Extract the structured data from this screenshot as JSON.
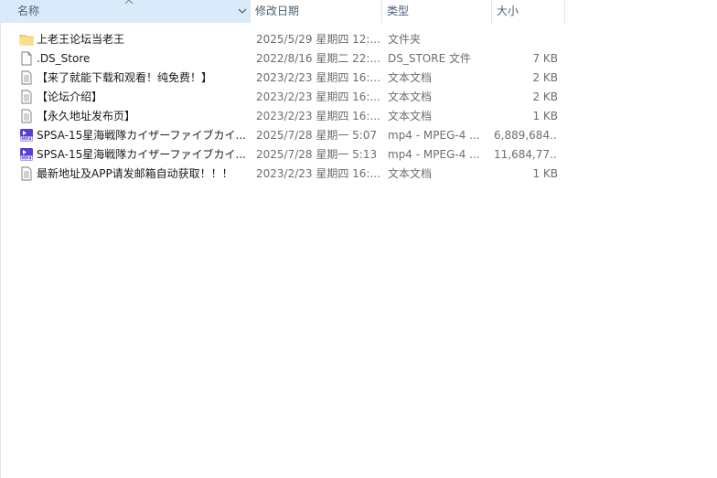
{
  "header": {
    "name": "名称",
    "date": "修改日期",
    "type": "类型",
    "size": "大小"
  },
  "files": [
    {
      "icon": "folder-icon",
      "name": "上老王论坛当老王",
      "date": "2025/5/29 星期四 12:...",
      "type": "文件夹",
      "size": ""
    },
    {
      "icon": "blank-file-icon",
      "name": ".DS_Store",
      "date": "2022/8/16 星期二 22:...",
      "type": "DS_STORE 文件",
      "size": "7 KB"
    },
    {
      "icon": "text-file-icon",
      "name": "【来了就能下载和观看！纯免费！】",
      "date": "2023/2/23 星期四 16:...",
      "type": "文本文档",
      "size": "2 KB"
    },
    {
      "icon": "text-file-icon",
      "name": "【论坛介绍】",
      "date": "2023/2/23 星期四 16:...",
      "type": "文本文档",
      "size": "2 KB"
    },
    {
      "icon": "text-file-icon",
      "name": "【永久地址发布页】",
      "date": "2023/2/23 星期四 16:...",
      "type": "文本文档",
      "size": "1 KB"
    },
    {
      "icon": "mp4-file-icon",
      "name": "SPSA-15星海戦隊カイザーファイブカイ...",
      "date": "2025/7/28 星期一 5:07",
      "type": "mp4 - MPEG-4 ...",
      "size": "6,889,684..."
    },
    {
      "icon": "mp4-file-icon",
      "name": "SPSA-15星海戦隊カイザーファイブカイ...",
      "date": "2025/7/28 星期一 5:13",
      "type": "mp4 - MPEG-4 ...",
      "size": "11,684,77..."
    },
    {
      "icon": "text-file-icon",
      "name": "最新地址及APP请发邮箱自动获取！！！",
      "date": "2023/2/23 星期四 16:...",
      "type": "文本文档",
      "size": "1 KB"
    }
  ],
  "colors": {
    "header_selected_bg": "#d9eafa",
    "header_text": "#4c607a",
    "folder_yellow": "#f8d775",
    "mp4_purple": "#5b3fd1"
  }
}
